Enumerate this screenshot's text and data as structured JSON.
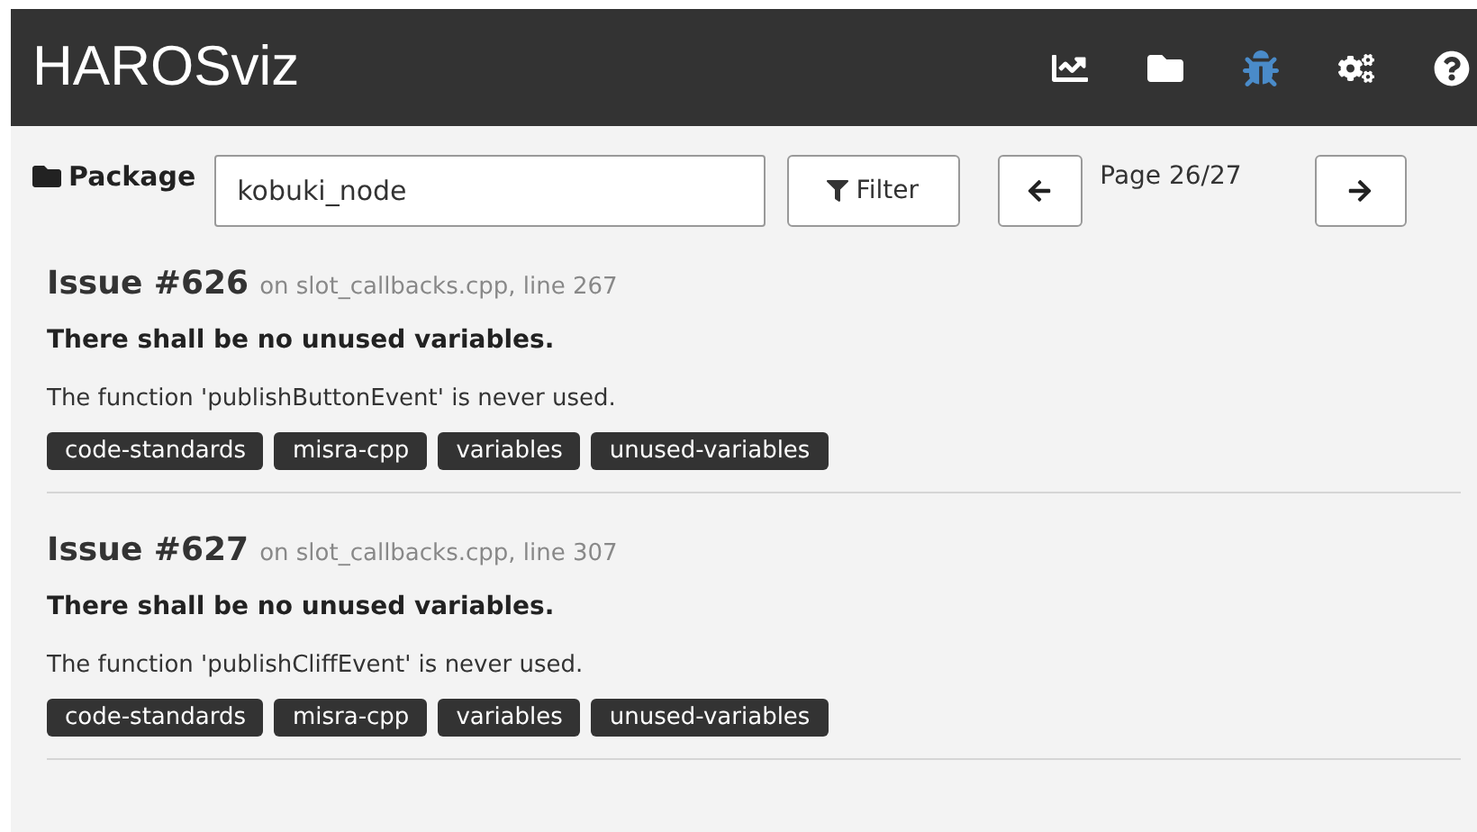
{
  "navbar": {
    "title": "HAROSviz",
    "items": [
      {
        "kind": "chart",
        "selected": false
      },
      {
        "kind": "folder",
        "selected": false
      },
      {
        "kind": "bug",
        "selected": true
      },
      {
        "kind": "cogs",
        "selected": false
      },
      {
        "kind": "help",
        "selected": false
      }
    ]
  },
  "filter_bar": {
    "label": "Package",
    "package_value": "kobuki_node",
    "filter_button": "Filter",
    "page": "Page 26/27"
  },
  "issues": [
    {
      "title": "Issue #626",
      "location": "on slot_callbacks.cpp, line 267",
      "rule": "There shall be no unused variables.",
      "description": "The function 'publishButtonEvent' is never used.",
      "tags": [
        "code-standards",
        "misra-cpp",
        "variables",
        "unused-variables"
      ]
    },
    {
      "title": "Issue #627",
      "location": "on slot_callbacks.cpp, line 307",
      "rule": "There shall be no unused variables.",
      "description": "The function 'publishCliffEvent' is never used.",
      "tags": [
        "code-standards",
        "misra-cpp",
        "variables",
        "unused-variables"
      ]
    }
  ]
}
